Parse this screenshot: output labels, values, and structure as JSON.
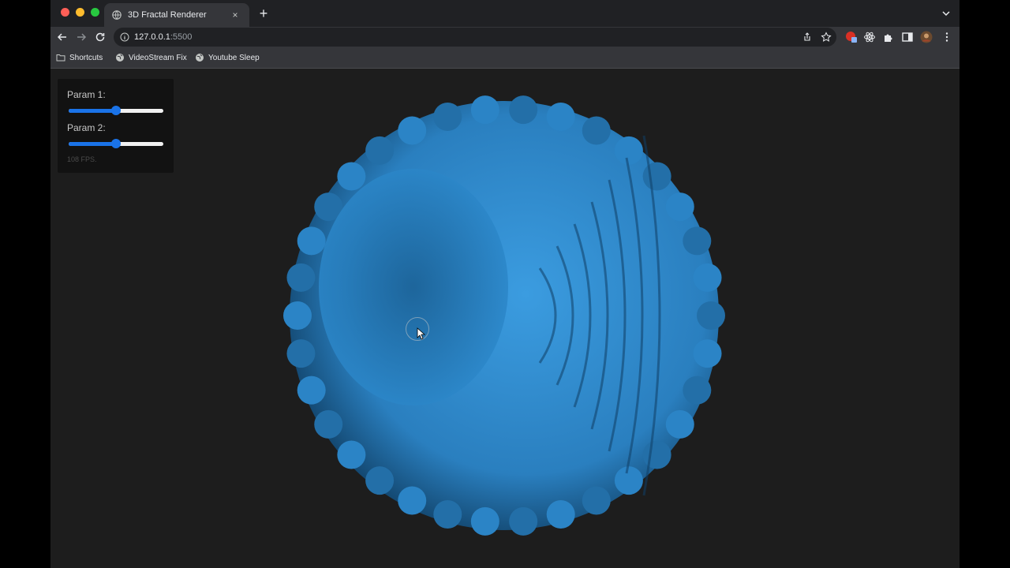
{
  "browser": {
    "tab": {
      "title": "3D Fractal Renderer",
      "close": "×"
    },
    "new_tab": "+",
    "address": {
      "host": "127.0.0.1",
      "port": ":5500"
    },
    "bookmarks": [
      {
        "label": "Shortcuts",
        "icon": "folder-icon"
      },
      {
        "label": "VideoStream Fix",
        "icon": "globe-icon"
      },
      {
        "label": "Youtube Sleep",
        "icon": "globe-icon"
      }
    ]
  },
  "controls": {
    "param1": {
      "label": "Param 1:",
      "value": 0.5
    },
    "param2": {
      "label": "Param 2:",
      "value": 0.5
    },
    "fps": "108 FPS."
  },
  "colors": {
    "fractal_blue": "#2a7fbf",
    "slider_accent": "#1a73e8",
    "page_background": "#1d1d1d"
  }
}
